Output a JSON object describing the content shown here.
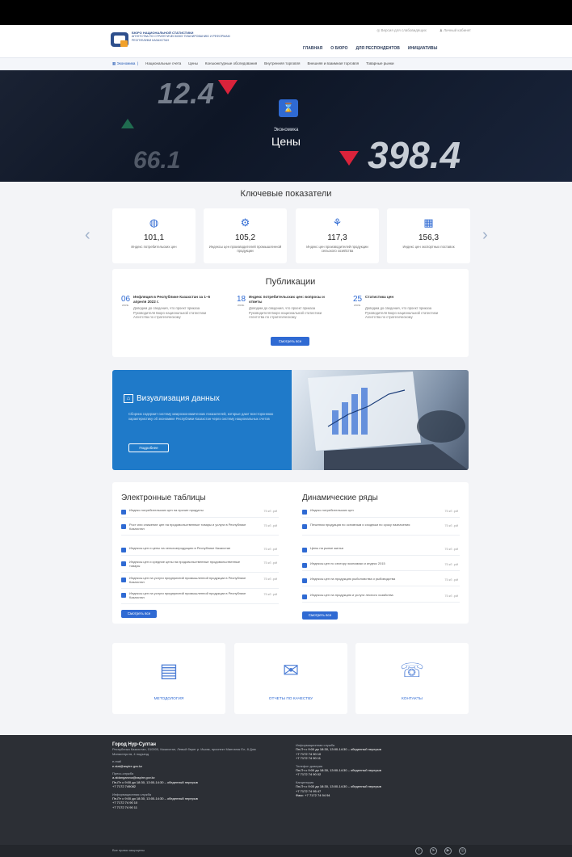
{
  "header": {
    "logo_title": "БЮРО НАЦИОНАЛЬНОЙ СТАТИСТИКИ",
    "logo_sub": "АГЕНТСТВА ПО СТРАТЕГИЧЕСКОМУ ПЛАНИРОВАНИЮ И РЕФОРМАМ РЕСПУБЛИКИ КАЗАХСТАН",
    "vision_label": "Версия для слабовидящих",
    "account_label": "Личный кабинет",
    "nav": [
      "ГЛАВНАЯ",
      "О БЮРО",
      "ДЛЯ РЕСПОНДЕНТОВ",
      "ИНИЦИАТИВЫ"
    ]
  },
  "subnav": [
    "Экономика",
    "Национальные счета",
    "Цены",
    "Конъюнктурные обследования",
    "Внутренняя торговля",
    "Внешняя и взаимная торговля",
    "Товарные рынки"
  ],
  "hero": {
    "numbers": [
      "12.4",
      "398.4",
      "66.1"
    ],
    "subtitle": "Экономика",
    "title": "Цены"
  },
  "kpi_title": "Ключевые показатели",
  "kpis": [
    {
      "value": "101,1",
      "label": "Индекс потребительских цен"
    },
    {
      "value": "105,2",
      "label": "Индексы цен производителей промышленной продукции"
    },
    {
      "value": "117,3",
      "label": "Индекс цен производителей продукции сельского хозяйства"
    },
    {
      "value": "156,3",
      "label": "Индекс цен экспортных поставок"
    }
  ],
  "publications": {
    "title": "Публикации",
    "items": [
      {
        "day": "06",
        "month": "июнь",
        "title": "Инфляция в Республике Казахстан за 1–6 апреля 2022 г.",
        "text": "Доводим до сведения, что проект приказа Руководителя Бюро национальной статистики Агентства по стратегическому"
      },
      {
        "day": "18",
        "month": "июнь",
        "title": "Индекс потребительских цен: вопросы и ответы",
        "text": "Доводим до сведения, что проект приказа Руководителя Бюро национальной статистики Агентства по стратегическому"
      },
      {
        "day": "25",
        "month": "июнь",
        "title": "Статистика цен",
        "text": "Доводим до сведения, что проект приказа Руководителя Бюро национальной статистики Агентства по стратегическому"
      }
    ],
    "button": "Смотреть все"
  },
  "viz": {
    "title": "Визуализация данных",
    "text": "Сборник содержит систему макроэкономических показателей, которые дают всестороннюю характеристику об экономике Республики Казахстан через систему национальных счетов",
    "button": "Подробнее"
  },
  "tables": {
    "title": "Электронные таблицы",
    "rows": [
      {
        "name": "Индекс потребительских цен на прочие продукты",
        "size": "75 кб .pdf"
      },
      {
        "name": "Рост или снижение цен на продовольственные товары и услуги в Республике Казахстан",
        "size": "75 кб .pdf"
      },
      {
        "name": "Индексы цен и цены на сельхозпродукцию в Республике Казахстан",
        "size": "75 кб .pdf"
      },
      {
        "name": "Индексы цен и средние цены на продовольственные продовольственные товары",
        "size": "75 кб .pdf"
      },
      {
        "name": "Индексы цен на услуги предприятий промышленной продукции в Республике Казахстан",
        "size": "75 кб .pdf"
      },
      {
        "name": "Индексы цен на услуги предприятий промышленной продукции в Республике Казахстан",
        "size": "75 кб .pdf"
      }
    ],
    "button": "Смотреть все"
  },
  "series": {
    "title": "Динамические ряды",
    "rows": [
      {
        "name": "Индекс потребительских цен",
        "size": "75 кб .pdf"
      },
      {
        "name": "Печатная продукция по основным и сходным по сроку назначения",
        "size": "75 кб .pdf"
      },
      {
        "name": "Цены на рынке жилья",
        "size": "75 кб .pdf"
      },
      {
        "name": "Индексы цен по сектору экономики и индекс 2015",
        "size": "75 кб .pdf"
      },
      {
        "name": "Индексы цен на продукцию рыболовства и рыбоводства",
        "size": "75 кб .pdf"
      },
      {
        "name": "Индексы цен на продукцию и услуги лесного хозяйства",
        "size": "75 кб .pdf"
      }
    ],
    "button": "Смотреть все"
  },
  "cards": [
    {
      "label": "МЕТОДОЛОГИЯ",
      "icon": "methodology-icon"
    },
    {
      "label": "ОТЧЕТЫ ПО КАЧЕСТВУ",
      "icon": "reports-icon"
    },
    {
      "label": "КОНТАКТЫ",
      "icon": "contacts-icon"
    }
  ],
  "footer": {
    "city": "Город Нур-Султан",
    "address": "Республика Казахстан, 010000, Казахстан, Левый берег р. Ишим, проспект Мангилик Ел, 8 Дом Министерств, 4 подъезд",
    "email_label": "e-mail",
    "email": "e.stat@aspire.gov.kz",
    "press_label": "Пресс-служба",
    "press_email": "a.aldangarova@aspire.gov.kz",
    "press_hours": "Пн-Пт с 9:00 до 18:30, 13:00-14:30 – обеденный перерыв",
    "press_phone": "+7 7172 749082",
    "info_label": "Информационная служба",
    "info_hours": "Пн-Пт с 9:00 до 18:30, 13:00-14:30 – обеденный перерыв",
    "info_phones": [
      "+7 7172 74 90 10",
      "+7 7172 74 90 11"
    ],
    "right_info_label": "Информационная служба",
    "right_info_hours": "Пн-Пт с 9:00 до 18:30, 13:00-14:30 – обеденный перерыв",
    "right_info_phones": [
      "+7 7172 74 90 10",
      "+7 7172 74 90 11"
    ],
    "helpdesk_label": "Телефон доверия",
    "helpdesk_hours": "Пн-Пт с 9:00 до 18:30, 13:00-14:30 – обеденный перерыв",
    "helpdesk_phone": "+7 7172 74 90 02",
    "office_label": "Канцелярия",
    "office_hours": "Пн-Пт с 9:00 до 18:30, 13:00-14:30 – обеденный перерыв",
    "office_phone": "+7 7172 74 95 47",
    "office_fax": "Факс: +7 7172 74 94 94",
    "copyright": "Все права защищены"
  },
  "colors": {
    "accent": "#2f6ad3",
    "viz_blue": "#1f7ac9",
    "footer": "#2c2f35",
    "hero_red": "#d9233b"
  }
}
